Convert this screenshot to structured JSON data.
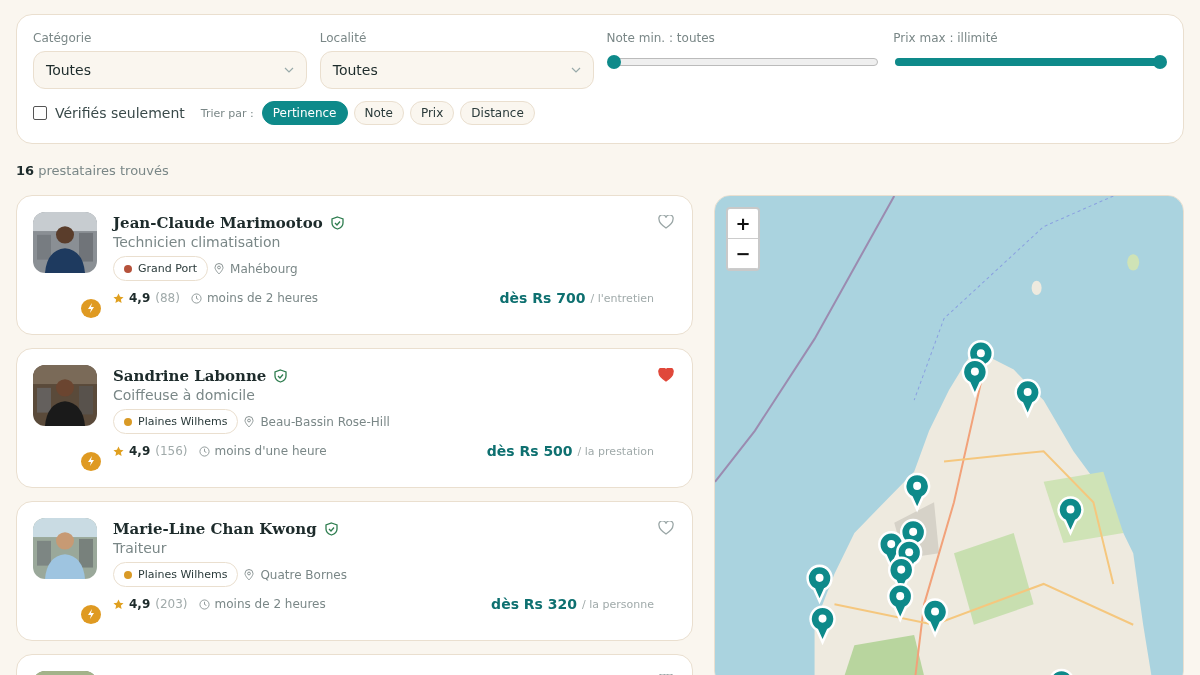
{
  "filters": {
    "category": {
      "label": "Catégorie",
      "value": "Toutes"
    },
    "locality": {
      "label": "Localité",
      "value": "Toutes"
    },
    "sliders": [
      {
        "label": "Note min. : toutes",
        "level": 0
      },
      {
        "label": "Prix max : illimité",
        "level": 1
      }
    ],
    "verified_only": {
      "label": "Vérifiés seulement",
      "checked": false
    },
    "sort": {
      "label": "Trier par :",
      "options": [
        {
          "label": "Pertinence",
          "selected": true
        },
        {
          "label": "Note",
          "selected": false
        },
        {
          "label": "Prix",
          "selected": false
        },
        {
          "label": "Distance",
          "selected": false
        }
      ]
    }
  },
  "results": {
    "count": "16",
    "label": "prestataires trouvés"
  },
  "cards": [
    {
      "name": "Jean-Claude Marimootoo",
      "verified": true,
      "favorite": false,
      "instant": true,
      "job": "Technicien climatisation",
      "region": {
        "label": "Grand Port",
        "color": "#b5523b"
      },
      "town": "Mahébourg",
      "rating": "4,9",
      "reviews": "(88)",
      "response": "moins de 2 heures",
      "price": "dès Rs 700",
      "unit": "/ l'entretien"
    },
    {
      "name": "Sandrine Labonne",
      "verified": true,
      "favorite": true,
      "instant": true,
      "job": "Coiffeuse à domicile",
      "region": {
        "label": "Plaines Wilhems",
        "color": "#d99a26"
      },
      "town": "Beau-Bassin Rose-Hill",
      "rating": "4,9",
      "reviews": "(156)",
      "response": "moins d'une heure",
      "price": "dès Rs 500",
      "unit": "/ la prestation"
    },
    {
      "name": "Marie-Line Chan Kwong",
      "verified": true,
      "favorite": false,
      "instant": true,
      "job": "Traiteur",
      "region": {
        "label": "Plaines Wilhems",
        "color": "#d99a26"
      },
      "town": "Quatre Bornes",
      "rating": "4,9",
      "reviews": "(203)",
      "response": "moins de 2 heures",
      "price": "dès Rs 320",
      "unit": "/ la personne"
    },
    {
      "kind": "partial",
      "favorite": false
    }
  ],
  "map": {
    "zoom_in": "+",
    "zoom_out": "−"
  }
}
